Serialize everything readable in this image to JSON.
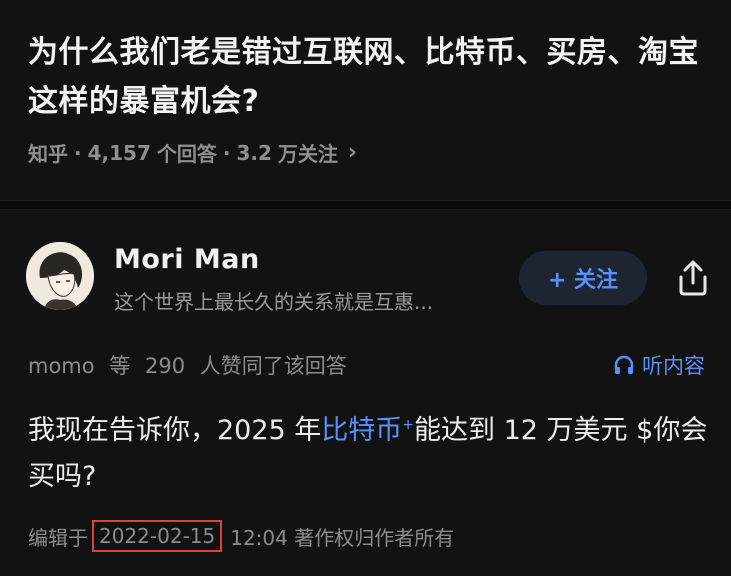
{
  "question": {
    "title": "为什么我们老是错过互联网、比特币、买房、淘宝这样的暴富机会?",
    "source": "知乎",
    "answer_count": "4,157",
    "answer_unit": "个回答",
    "follow_count": "3.2",
    "follow_unit": "万关注"
  },
  "author": {
    "name": "Mori Man",
    "bio": "这个世界上最长久的关系就是互惠...",
    "follow_label": "+ 关注"
  },
  "likes": {
    "user": "momo",
    "deng": "等",
    "count": "290",
    "text": "人赞同了该回答"
  },
  "listen_label": "听内容",
  "answer": {
    "part1": "我现在告诉你，2025 年",
    "link": "比特币",
    "link_mark": "+",
    "part2": "能达到 12 万美元 $你会买吗?"
  },
  "footer": {
    "edit_label": "编辑于",
    "date": "2022-02-15",
    "time_and_copyright": "12:04 著作权归作者所有"
  },
  "colors": {
    "background": "#121212",
    "accent": "#5b8ff9",
    "highlight_box": "#e0413c"
  }
}
